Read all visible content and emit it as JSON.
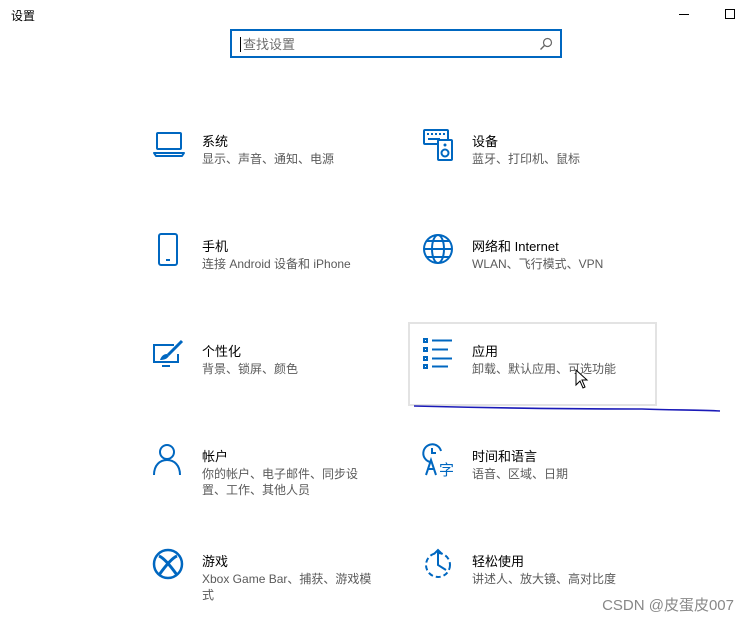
{
  "window": {
    "title": "设置"
  },
  "search": {
    "placeholder": "查找设置"
  },
  "accent_color": "#0067c0",
  "annotation_color": "#1a1ab8",
  "tiles": [
    {
      "id": "system",
      "icon": "laptop-icon",
      "title": "系统",
      "desc": "显示、声音、通知、电源"
    },
    {
      "id": "devices",
      "icon": "keyboard-speaker-icon",
      "title": "设备",
      "desc": "蓝牙、打印机、鼠标"
    },
    {
      "id": "phone",
      "icon": "phone-icon",
      "title": "手机",
      "desc": "连接 Android 设备和 iPhone"
    },
    {
      "id": "network",
      "icon": "globe-icon",
      "title": "网络和 Internet",
      "desc": "WLAN、飞行模式、VPN"
    },
    {
      "id": "personalization",
      "icon": "paint-brush-icon",
      "title": "个性化",
      "desc": "背景、锁屏、颜色"
    },
    {
      "id": "apps",
      "icon": "apps-list-icon",
      "title": "应用",
      "desc": "卸载、默认应用、可选功能"
    },
    {
      "id": "accounts",
      "icon": "person-icon",
      "title": "帐户",
      "desc": "你的帐户、电子邮件、同步设置、工作、其他人员"
    },
    {
      "id": "time-language",
      "icon": "clock-language-icon",
      "title": "时间和语言",
      "desc": "语音、区域、日期"
    },
    {
      "id": "gaming",
      "icon": "xbox-icon",
      "title": "游戏",
      "desc": "Xbox Game Bar、捕获、游戏模式"
    },
    {
      "id": "ease-of-access",
      "icon": "ease-of-access-icon",
      "title": "轻松使用",
      "desc": "讲述人、放大镜、高对比度"
    }
  ],
  "watermark": "CSDN @皮蛋皮007"
}
